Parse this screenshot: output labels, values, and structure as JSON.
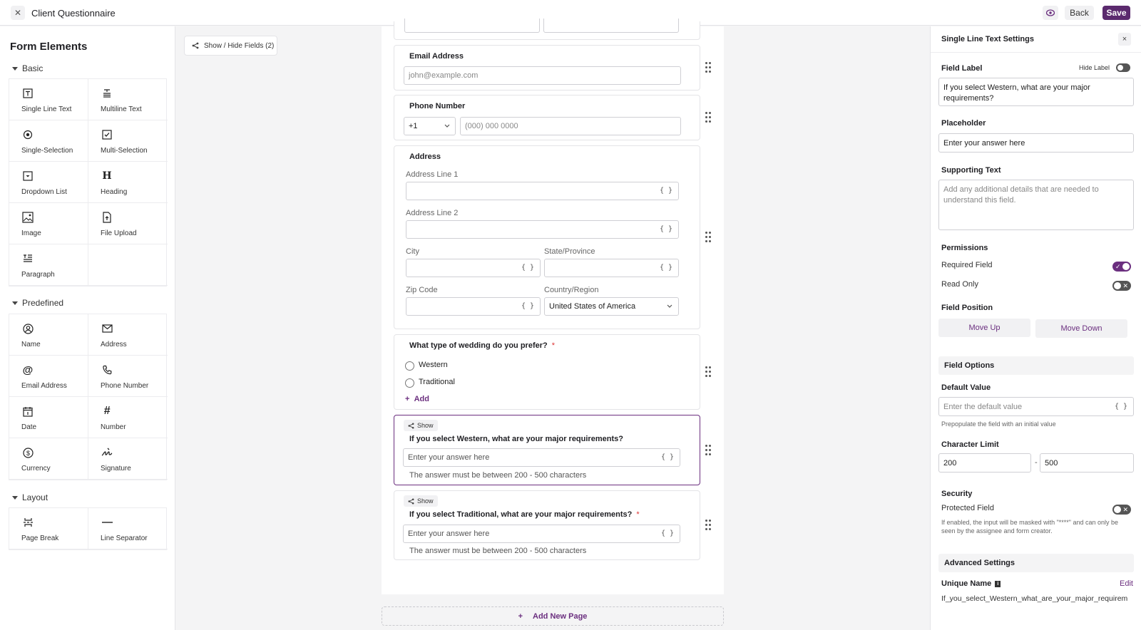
{
  "topbar": {
    "close_icon": "close-icon",
    "title": "Client Questionnaire",
    "preview_icon": "eye-icon",
    "back_label": "Back",
    "save_label": "Save"
  },
  "left_panel": {
    "title": "Form Elements",
    "basic": {
      "heading": "Basic",
      "items": [
        {
          "label": "Single Line Text",
          "icon": "text-t-icon"
        },
        {
          "label": "Multiline Text",
          "icon": "text-lines-icon"
        },
        {
          "label": "Single-Selection",
          "icon": "radio-icon"
        },
        {
          "label": "Multi-Selection",
          "icon": "checkbox-icon"
        },
        {
          "label": "Dropdown List",
          "icon": "dropdown-icon"
        },
        {
          "label": "Heading",
          "icon": "heading-icon"
        },
        {
          "label": "Image",
          "icon": "image-icon"
        },
        {
          "label": "File Upload",
          "icon": "file-upload-icon"
        },
        {
          "label": "Paragraph",
          "icon": "paragraph-icon"
        }
      ]
    },
    "predefined": {
      "heading": "Predefined",
      "items": [
        {
          "label": "Name",
          "icon": "user-icon"
        },
        {
          "label": "Address",
          "icon": "envelope-icon"
        },
        {
          "label": "Email Address",
          "icon": "at-icon"
        },
        {
          "label": "Phone Number",
          "icon": "phone-icon"
        },
        {
          "label": "Date",
          "icon": "calendar-icon"
        },
        {
          "label": "Number",
          "icon": "hash-icon"
        },
        {
          "label": "Currency",
          "icon": "dollar-icon"
        },
        {
          "label": "Signature",
          "icon": "signature-icon"
        }
      ]
    },
    "layout": {
      "heading": "Layout",
      "items": [
        {
          "label": "Page Break",
          "icon": "page-break-icon"
        },
        {
          "label": "Line Separator",
          "icon": "line-separator-icon"
        }
      ]
    }
  },
  "canvas": {
    "show_hide_label": "Show / Hide Fields (2)",
    "email": {
      "label": "Email Address",
      "placeholder": "john@example.com"
    },
    "phone": {
      "label": "Phone Number",
      "country_code": "+1",
      "placeholder": "(000) 000 0000"
    },
    "address": {
      "label": "Address",
      "line1": "Address Line 1",
      "line2": "Address Line 2",
      "city": "City",
      "state": "State/Province",
      "zip": "Zip Code",
      "country_label": "Country/Region",
      "country_value": "United States of America",
      "brace": "{ }"
    },
    "wedding": {
      "label": "What type of wedding do you prefer?",
      "required_mark": "*",
      "options": [
        "Western",
        "Traditional"
      ],
      "add_label": "Add",
      "add_icon": "+"
    },
    "western_q": {
      "show_tag": "Show",
      "label": "If you select Western, what are your major requirements?",
      "placeholder": "Enter your answer here",
      "hint": "The answer must be between 200 - 500 characters"
    },
    "traditional_q": {
      "show_tag": "Show",
      "label": "If you select Traditional, what are your major requirements?",
      "required_mark": "*",
      "placeholder": "Enter your answer here",
      "hint": "The answer must be between 200 - 500 characters"
    },
    "add_page_icon": "+",
    "add_page_label": "Add New Page"
  },
  "settings": {
    "title": "Single Line Text Settings",
    "close_label": "×",
    "field_label_heading": "Field Label",
    "hide_label": "Hide Label",
    "field_label_value": "If you select Western, what are your major requirements?",
    "placeholder_heading": "Placeholder",
    "placeholder_value": "Enter your answer here",
    "supporting_heading": "Supporting Text",
    "supporting_placeholder": "Add any additional details that are needed to understand this field.",
    "permissions_heading": "Permissions",
    "required_label": "Required Field",
    "required_on": true,
    "readonly_label": "Read Only",
    "readonly_on": false,
    "position_heading": "Field Position",
    "move_up": "Move Up",
    "move_down": "Move Down",
    "field_options_heading": "Field Options",
    "default_value_heading": "Default Value",
    "default_value_placeholder": "Enter the default value",
    "default_value_hint": "Prepopulate the field with an initial value",
    "char_limit_heading": "Character Limit",
    "char_min": "200",
    "char_sep": "-",
    "char_max": "500",
    "security_heading": "Security",
    "protected_label": "Protected Field",
    "protected_on": false,
    "protected_hint": "If enabled, the input will be masked with \"****\" and can only be seen by the assignee and form creator.",
    "advanced_heading": "Advanced Settings",
    "unique_name_heading": "Unique Name",
    "edit_label": "Edit",
    "unique_name_value": "If_you_select_Western_what_are_your_major_requirem"
  },
  "colors": {
    "accent": "#6b2f7f",
    "save_bg": "#5b2a6e",
    "canvas_bg": "#f4f4f5"
  }
}
